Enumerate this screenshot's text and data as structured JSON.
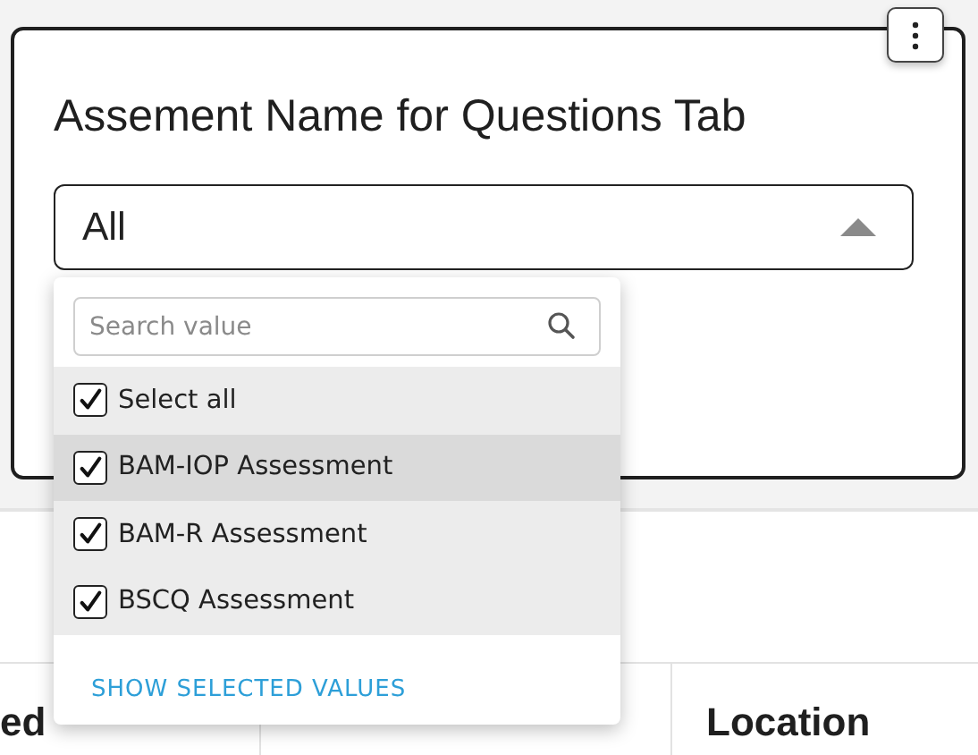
{
  "filter_card": {
    "title": "Assement Name for Questions Tab",
    "select": {
      "value": "All",
      "expanded": true
    }
  },
  "dropdown": {
    "search": {
      "placeholder": "Search value"
    },
    "options": [
      {
        "label": "Select all",
        "checked": true,
        "highlighted": false
      },
      {
        "label": "BAM-IOP Assessment",
        "checked": true,
        "highlighted": true
      },
      {
        "label": "BAM-R Assessment",
        "checked": true,
        "highlighted": false
      },
      {
        "label": "BSCQ Assessment",
        "checked": true,
        "highlighted": false
      }
    ],
    "footer_link": "SHOW SELECTED VALUES"
  },
  "table": {
    "columns": [
      "ed",
      "Location"
    ]
  }
}
